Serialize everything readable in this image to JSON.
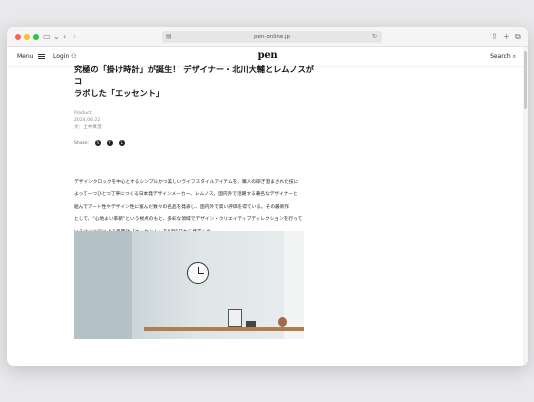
{
  "browser": {
    "url": "pen-online.jp",
    "lock": "🔒"
  },
  "site": {
    "logo": "pen",
    "menu_label": "Menu",
    "login_label": "Login",
    "search_label": "Search"
  },
  "article": {
    "headline_line1": "究極の「掛け時計」が誕生！ デザイナー・北川大輔とレムノスがコ",
    "headline_line2": "ラボした「エッセント」",
    "category": "Product",
    "date": "2024.06.22",
    "author": "文：土中真澄",
    "share_label": "Share:",
    "body_1": "デザインクロックを中心とするシンプルかつ美しいライフスタイルアイテムを、職人の研ぎ澄まされた技に",
    "body_2": "よって一つひとつ丁寧につくる日本発デザインメーカー、レムノス。国内外で活躍する著名なデザイナーと",
    "body_3": "組んでアート性やデザイン性に富んだ数々の名品を発表し、国内外で高い評価を得ている。その最新作",
    "body_4": "として、“心地よい革新”という視点のもと、多彩な領域でデザイン・クリエイティブディレクションを行って",
    "body_5_pre": "いる",
    "body_5_link": "北川大輔",
    "body_5_post": "による掛時計「エッセント」を6月5日から発売した。"
  },
  "colors": {
    "link": "#b06a5a",
    "traffic_red": "#fe5f57",
    "traffic_yellow": "#febc2e",
    "traffic_green": "#28c840"
  }
}
